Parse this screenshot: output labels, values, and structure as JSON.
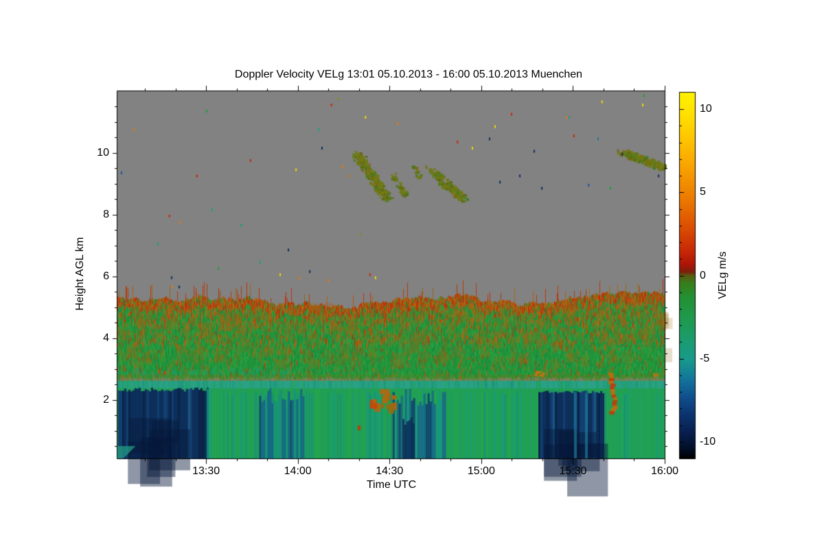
{
  "title": "Doppler Velocity VELg   13:01 05.10.2013 - 16:00 05.10.2013 Muenchen",
  "x_axis": {
    "label": "Time UTC",
    "start": "13:01",
    "end": "16:00",
    "tick_labels": [
      "13:30",
      "14:00",
      "14:30",
      "15:00",
      "15:30",
      "16:00"
    ],
    "tick_minutes": [
      29,
      59,
      89,
      119,
      149,
      179
    ],
    "minor_tick_minutes": [
      9,
      19,
      39,
      49,
      69,
      79,
      99,
      109,
      129,
      139,
      159,
      169
    ],
    "range_minutes": [
      0,
      179
    ]
  },
  "y_axis": {
    "label": "Height AGL km",
    "tick_labels": [
      "2",
      "4",
      "6",
      "8",
      "10"
    ],
    "tick_values": [
      2,
      4,
      6,
      8,
      10
    ],
    "minor_step_km": 0.5,
    "range_km": [
      0.1,
      12.0
    ]
  },
  "colorbar": {
    "label": "VELg m/s",
    "tick_labels": [
      "10",
      "5",
      "0",
      "-5",
      "-10"
    ],
    "tick_values": [
      10,
      5,
      0,
      -5,
      -10
    ],
    "range": [
      -11,
      11
    ],
    "minor_step": 1,
    "stops": [
      [
        0.0,
        "#fff200"
      ],
      [
        0.06,
        "#ffe000"
      ],
      [
        0.14,
        "#ffbf00"
      ],
      [
        0.22,
        "#f79b00"
      ],
      [
        0.3,
        "#ea7500"
      ],
      [
        0.37,
        "#db4d03"
      ],
      [
        0.43,
        "#c92a06"
      ],
      [
        0.47,
        "#ad1507"
      ],
      [
        0.49,
        "#7c1e0d"
      ],
      [
        0.5,
        "#585a10"
      ],
      [
        0.52,
        "#387d1b"
      ],
      [
        0.56,
        "#239134"
      ],
      [
        0.62,
        "#1f9a4e"
      ],
      [
        0.68,
        "#1b9c71"
      ],
      [
        0.73,
        "#189a8c"
      ],
      [
        0.78,
        "#13789b"
      ],
      [
        0.83,
        "#10518f"
      ],
      [
        0.88,
        "#0c346f"
      ],
      [
        0.93,
        "#081f4e"
      ],
      [
        0.97,
        "#03102b"
      ],
      [
        1.0,
        "#000000"
      ]
    ]
  },
  "colors": {
    "background": "#ffffff",
    "no_data_gray": "#828282",
    "axis": "#000000",
    "greens": [
      "#1f9734",
      "#239c38",
      "#1b9040",
      "#27a043",
      "#188c38"
    ],
    "oranges": [
      "#a96a10",
      "#b05f12",
      "#9a7014",
      "#8f6a16",
      "#b3540d"
    ],
    "reds": [
      "#bb3a06",
      "#c22f08",
      "#a93c0a"
    ],
    "teal_band": "#2aa184",
    "lower_base": "#21a053",
    "lower_streaks": [
      "#1c9b72",
      "#1ba263",
      "#189a7e",
      "#25a54a",
      "#168f78"
    ],
    "navy_strips": [
      "#0d2c5b",
      "#0a2147",
      "#133c72",
      "#1b5585"
    ],
    "speckle_palette": {
      "g": "#18a03c",
      "o": "#e0790f",
      "r": "#cc2406",
      "l": "#8a8a14",
      "y": "#f2d800",
      "t": "#16a089",
      "n": "#0d2a60",
      "b": "#1456a0",
      "s": "#2b709e"
    },
    "cloud_olives": [
      "#707a18",
      "#5d6c12",
      "#477c1d",
      "#7c6a12"
    ]
  },
  "chart_data": {
    "type": "heatmap",
    "title": "Doppler Velocity VELg   13:01 05.10.2013 - 16:00 05.10.2013 Muenchen",
    "xlabel": "Time UTC",
    "ylabel": "Height AGL km",
    "zlabel": "VELg m/s",
    "x_domain_utc": [
      "13:01",
      "16:00"
    ],
    "y_domain_km": [
      0.1,
      12.0
    ],
    "z_domain_ms": [
      -11,
      11
    ],
    "grid": false,
    "legend": "vertical colorbar right",
    "no_data_above_km": 5.45,
    "regions": [
      {
        "name": "cloud-top-spiky-band",
        "t_min": [
          0,
          179
        ],
        "h_km": [
          4.9,
          5.6
        ],
        "vel_ms": "+1 to +5",
        "look": "red/orange grass-like spikes over green"
      },
      {
        "name": "mottled-mid-layer",
        "t_min": [
          0,
          179
        ],
        "h_km": [
          3.9,
          5.2
        ],
        "vel_ms": "-1 to +3",
        "look": "green with orange-brown mottling"
      },
      {
        "name": "green-layer",
        "t_min": [
          0,
          179
        ],
        "h_km": [
          2.5,
          4.0
        ],
        "vel_ms": "about -1.5",
        "look": "mostly uniform green"
      },
      {
        "name": "melting-band",
        "t_min": [
          0,
          179
        ],
        "h_km": [
          2.25,
          2.5
        ],
        "vel_ms": "about -4",
        "look": "light teal horizontal band"
      },
      {
        "name": "sub-cloud-layer",
        "t_min": [
          0,
          179
        ],
        "h_km": [
          0.1,
          2.3
        ],
        "vel_ms": "-2 to -6",
        "look": "green/teal vertical streaks"
      },
      {
        "name": "downdraft-block-1",
        "t_min": [
          0.2,
          29.2
        ],
        "h_km": [
          0.1,
          2.4
        ],
        "vel_ms": "-7 to -10",
        "look": "dark navy block"
      },
      {
        "name": "downdraft-streaks-1",
        "t_min": [
          45,
          60.5
        ],
        "h_km": [
          0.1,
          2.4
        ],
        "vel_ms": "-4 to -7",
        "look": "teal/navy streaks"
      },
      {
        "name": "downdraft-streaks-2",
        "t_min": [
          90,
          107
        ],
        "h_km": [
          0.1,
          2.35
        ],
        "vel_ms": "-4 to -8",
        "look": "blue-teal streaks, navy core"
      },
      {
        "name": "downdraft-block-2",
        "t_min": [
          137.7,
          158.8
        ],
        "h_km": [
          0.1,
          2.3
        ],
        "vel_ms": "-7 to -10",
        "look": "dark navy block"
      },
      {
        "name": "updraft-orange-1",
        "t_min": [
          81,
          90
        ],
        "h_km": [
          1.3,
          2.3
        ],
        "vel_ms": "+2 to +4"
      },
      {
        "name": "updraft-orange-2",
        "t_min": [
          161,
          164.5
        ],
        "h_km": [
          1.4,
          2.9
        ],
        "vel_ms": "+2 to +5"
      },
      {
        "name": "updraft-orange-3",
        "t_min": [
          136,
          139
        ],
        "h_km": [
          2.7,
          3.0
        ],
        "vel_ms": "+2"
      }
    ],
    "cirrus_clouds": [
      {
        "t1": 78,
        "h1": 10.0,
        "t2": 88,
        "h2": 8.55,
        "n": 260,
        "jx": 14,
        "jy": 10
      },
      {
        "t1": 90,
        "h1": 9.3,
        "t2": 94,
        "h2": 8.6,
        "n": 46,
        "jx": 8,
        "jy": 7
      },
      {
        "t1": 96.5,
        "h1": 9.65,
        "t2": 98.5,
        "h2": 9.2,
        "n": 18,
        "jx": 6,
        "jy": 6
      },
      {
        "t1": 102,
        "h1": 9.5,
        "t2": 113,
        "h2": 8.5,
        "n": 170,
        "jx": 12,
        "jy": 9
      },
      {
        "t1": 165,
        "h1": 10.05,
        "t2": 179,
        "h2": 9.55,
        "n": 300,
        "jx": 16,
        "jy": 7
      }
    ],
    "speckles": [
      [
        29.0,
        11.4,
        "g"
      ],
      [
        5.2,
        10.8,
        "o"
      ],
      [
        69.8,
        11.6,
        "r"
      ],
      [
        72.1,
        11.8,
        "l"
      ],
      [
        80.9,
        11.2,
        "y"
      ],
      [
        65.6,
        10.8,
        "t"
      ],
      [
        66.7,
        10.2,
        "n"
      ],
      [
        43.3,
        9.8,
        "r"
      ],
      [
        58.2,
        9.5,
        "y"
      ],
      [
        73.4,
        9.6,
        "o"
      ],
      [
        1.1,
        9.4,
        "b"
      ],
      [
        25.8,
        9.3,
        "r"
      ],
      [
        75.5,
        9.3,
        "o"
      ],
      [
        91.4,
        11.0,
        "o"
      ],
      [
        128.7,
        11.3,
        "r"
      ],
      [
        123.3,
        10.9,
        "y"
      ],
      [
        158.3,
        11.7,
        "y"
      ],
      [
        171.6,
        11.6,
        "y"
      ],
      [
        172.0,
        11.9,
        "g"
      ],
      [
        146.7,
        11.2,
        "o"
      ],
      [
        147.6,
        11.2,
        "t"
      ],
      [
        149.1,
        10.6,
        "r"
      ],
      [
        121.5,
        10.5,
        "n"
      ],
      [
        157.0,
        10.5,
        "s"
      ],
      [
        111.0,
        10.4,
        "r"
      ],
      [
        115.9,
        10.2,
        "y"
      ],
      [
        136.1,
        10.1,
        "n"
      ],
      [
        164.9,
        10.0,
        "n"
      ],
      [
        131.4,
        9.3,
        "n"
      ],
      [
        124.9,
        9.1,
        "n"
      ],
      [
        138.6,
        8.9,
        "n"
      ],
      [
        153.9,
        9.0,
        "b"
      ],
      [
        161.0,
        8.9,
        "g"
      ],
      [
        176.8,
        9.3,
        "n"
      ],
      [
        16.8,
        8.0,
        "r"
      ],
      [
        20.2,
        7.8,
        "o"
      ],
      [
        30.8,
        8.2,
        "t"
      ],
      [
        40.4,
        7.7,
        "t"
      ],
      [
        13.0,
        7.1,
        "t"
      ],
      [
        55.7,
        6.9,
        "n"
      ],
      [
        46.5,
        6.5,
        "t"
      ],
      [
        32.8,
        6.3,
        "g"
      ],
      [
        79.3,
        7.4,
        "l"
      ],
      [
        17.5,
        6.0,
        "n"
      ],
      [
        17.7,
        5.7,
        "o"
      ],
      [
        20.0,
        5.7,
        "n"
      ],
      [
        62.7,
        6.2,
        "n"
      ],
      [
        53.0,
        6.1,
        "y"
      ],
      [
        59.3,
        6.0,
        "o"
      ],
      [
        68.7,
        5.9,
        "o"
      ],
      [
        82.4,
        6.1,
        "r"
      ],
      [
        84.2,
        6.0,
        "y"
      ]
    ]
  }
}
